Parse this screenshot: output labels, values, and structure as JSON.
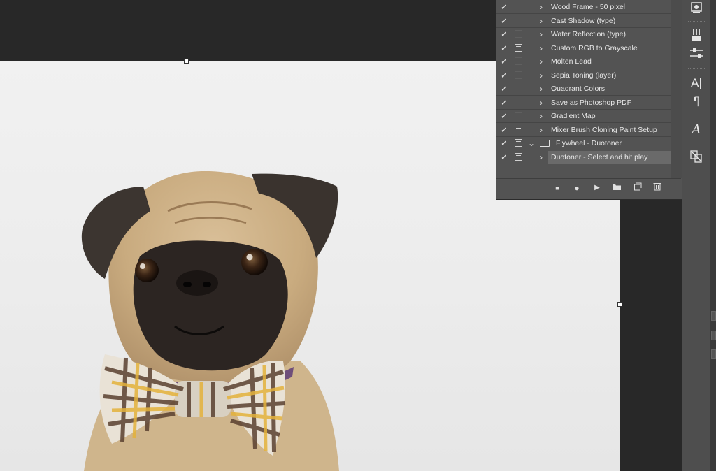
{
  "actions": {
    "items": [
      {
        "label": "Wood Frame - 50 pixel",
        "checked": true,
        "dialog": false,
        "type": "action"
      },
      {
        "label": "Cast Shadow (type)",
        "checked": true,
        "dialog": false,
        "type": "action"
      },
      {
        "label": "Water Reflection (type)",
        "checked": true,
        "dialog": false,
        "type": "action"
      },
      {
        "label": "Custom RGB to Grayscale",
        "checked": true,
        "dialog": true,
        "type": "action"
      },
      {
        "label": "Molten Lead",
        "checked": true,
        "dialog": false,
        "type": "action"
      },
      {
        "label": "Sepia Toning (layer)",
        "checked": true,
        "dialog": false,
        "type": "action"
      },
      {
        "label": "Quadrant Colors",
        "checked": true,
        "dialog": false,
        "type": "action"
      },
      {
        "label": "Save as Photoshop PDF",
        "checked": true,
        "dialog": true,
        "type": "action"
      },
      {
        "label": "Gradient Map",
        "checked": true,
        "dialog": false,
        "type": "action"
      },
      {
        "label": "Mixer Brush Cloning Paint Setup",
        "checked": true,
        "dialog": true,
        "type": "action"
      },
      {
        "label": "Flywheel - Duotoner",
        "checked": true,
        "dialog": true,
        "type": "set"
      },
      {
        "label": "Duotoner - Select and hit play",
        "checked": true,
        "dialog": true,
        "type": "action",
        "selected": true
      }
    ],
    "footer_buttons": [
      "stop-icon",
      "record-icon",
      "play-icon",
      "new-set-icon",
      "new-action-icon",
      "trash-icon"
    ]
  },
  "glyphs": {
    "check": "✓",
    "chevron_right": "›",
    "chevron_down": "⌄",
    "stop": "■",
    "record": "●",
    "play": "▶",
    "trash": "🗑"
  },
  "right_strip": {
    "icons": [
      "libraries-icon",
      "brush-presets-icon",
      "adjustments-icon",
      "character-icon",
      "paragraph-icon",
      "glyphs-icon",
      "paths-icon"
    ]
  },
  "colors": {
    "panel_bg": "#535353",
    "workspace_bg": "#282828",
    "selection": "#6a6a6a"
  }
}
